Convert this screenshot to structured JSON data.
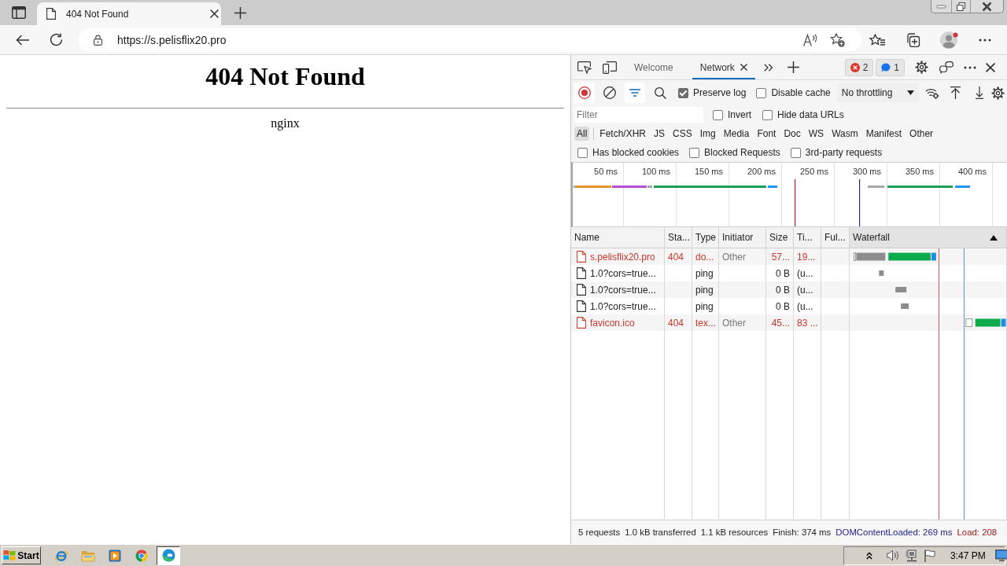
{
  "browser": {
    "tabs": [
      {
        "title": "404 Not Found",
        "selected": true
      }
    ],
    "address": "https://s.pelisflix20.pro"
  },
  "page": {
    "heading": "404 Not Found",
    "server": "nginx"
  },
  "devtools": {
    "tabs": [
      {
        "label": "Welcome",
        "selected": false,
        "closable": false
      },
      {
        "label": "Network",
        "selected": true,
        "closable": true
      }
    ],
    "issues": [
      {
        "kind": "error",
        "count": "2"
      },
      {
        "kind": "message",
        "count": "1"
      }
    ],
    "toolbar": {
      "recording": true,
      "filter_open": true,
      "options": [
        {
          "label": "Preserve log",
          "checked": true
        },
        {
          "label": "Disable cache",
          "checked": false
        }
      ],
      "throttling": "No throttling"
    },
    "filter": {
      "placeholder": "Filter",
      "options": [
        {
          "label": "Invert",
          "checked": false
        },
        {
          "label": "Hide data URLs",
          "checked": false
        }
      ]
    },
    "types": [
      {
        "label": "All",
        "selected": true
      },
      {
        "label": "Fetch/XHR",
        "selected": false
      },
      {
        "label": "JS",
        "selected": false
      },
      {
        "label": "CSS",
        "selected": false
      },
      {
        "label": "Img",
        "selected": false
      },
      {
        "label": "Media",
        "selected": false
      },
      {
        "label": "Font",
        "selected": false
      },
      {
        "label": "Doc",
        "selected": false
      },
      {
        "label": "WS",
        "selected": false
      },
      {
        "label": "Wasm",
        "selected": false
      },
      {
        "label": "Manifest",
        "selected": false
      },
      {
        "label": "Other",
        "selected": false
      }
    ],
    "request_filters": [
      {
        "label": "Has blocked cookies",
        "checked": false
      },
      {
        "label": "Blocked Requests",
        "checked": false
      },
      {
        "label": "3rd-party requests",
        "checked": false
      }
    ],
    "overview": {
      "ticks": [
        "50 ms",
        "100 ms",
        "150 ms",
        "200 ms",
        "250 ms",
        "300 ms",
        "350 ms",
        "400 ms"
      ]
    },
    "columns": [
      {
        "label": "Name",
        "sorted": false
      },
      {
        "label": "Sta...",
        "sorted": false
      },
      {
        "label": "Type",
        "sorted": false
      },
      {
        "label": "Initiator",
        "sorted": false
      },
      {
        "label": "Size",
        "sorted": false
      },
      {
        "label": "Ti...",
        "sorted": false
      },
      {
        "label": "Ful...",
        "sorted": false
      },
      {
        "label": "Waterfall",
        "sorted": true
      }
    ],
    "rows": [
      {
        "name": "s.pelisflix20.pro",
        "status": "404",
        "type": "do...",
        "initiator": "Other",
        "size": "57...",
        "time": "19...",
        "error": true
      },
      {
        "name": "1.0?cors=true...",
        "type": "ping",
        "size": "0 B",
        "time": "(u...",
        "error": false
      },
      {
        "name": "1.0?cors=true...",
        "type": "ping",
        "size": "0 B",
        "time": "(u...",
        "error": false
      },
      {
        "name": "1.0?cors=true...",
        "type": "ping",
        "size": "0 B",
        "time": "(u...",
        "error": false
      },
      {
        "name": "favicon.ico",
        "status": "404",
        "type": "tex...",
        "initiator": "Other",
        "size": "45...",
        "time": "83 ...",
        "error": true
      }
    ],
    "summary": [
      {
        "text": "5 requests",
        "kind": "plain"
      },
      {
        "text": "1.0 kB transferred",
        "kind": "plain"
      },
      {
        "text": "1.1 kB resources",
        "kind": "plain"
      },
      {
        "text": "Finish: 374 ms",
        "kind": "plain"
      },
      {
        "text": "DOMContentLoaded: 269 ms",
        "kind": "dcl"
      },
      {
        "text": "Load: 208",
        "kind": "load"
      }
    ]
  },
  "taskbar": {
    "start": "Start",
    "apps": [
      {
        "kind": "ie",
        "selected": false
      },
      {
        "kind": "folder",
        "selected": false
      },
      {
        "kind": "media",
        "selected": false
      },
      {
        "kind": "chrome",
        "selected": false
      },
      {
        "kind": "edge",
        "selected": true
      }
    ],
    "clock": "3:47 PM"
  }
}
